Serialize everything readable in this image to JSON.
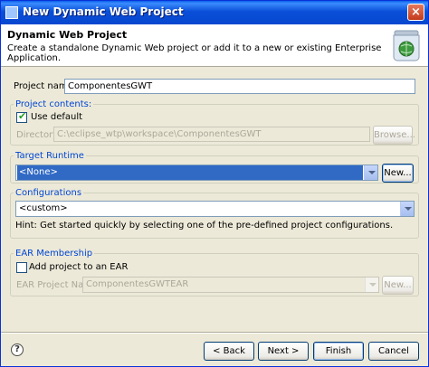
{
  "window": {
    "title": "New Dynamic Web Project",
    "close_label": "×"
  },
  "header": {
    "title": "Dynamic Web Project",
    "description": "Create a standalone Dynamic Web project or add it to a new or existing Enterprise Application."
  },
  "project_name": {
    "label": "Project name:",
    "value": "ComponentesGWT"
  },
  "project_contents": {
    "legend": "Project contents:",
    "use_default_label": "Use default",
    "use_default_checked": true,
    "directory_label": "Directory:",
    "directory_value": "C:\\eclipse_wtp\\workspace\\ComponentesGWT",
    "browse_label": "Browse..."
  },
  "target_runtime": {
    "legend": "Target Runtime",
    "value": "<None>",
    "new_label": "New..."
  },
  "configurations": {
    "legend": "Configurations",
    "value": "<custom>",
    "hint": "Hint: Get started quickly by selecting one of the pre-defined project configurations."
  },
  "ear_membership": {
    "legend": "EAR Membership",
    "add_label": "Add project to an EAR",
    "add_checked": false,
    "ear_name_label": "EAR Project Name:",
    "ear_name_value": "ComponentesGWTEAR",
    "new_label": "New..."
  },
  "footer": {
    "help_label": "?",
    "back_label": "< Back",
    "next_label": "Next >",
    "finish_label": "Finish",
    "cancel_label": "Cancel"
  },
  "colors": {
    "titlebar": "#0a4fd8",
    "selection": "#316ac5",
    "legend": "#0046d5",
    "dialog_bg": "#ece9d8"
  },
  "icons": [
    "jar-globe-icon",
    "help-icon",
    "close-icon",
    "checkbox-check-icon"
  ]
}
